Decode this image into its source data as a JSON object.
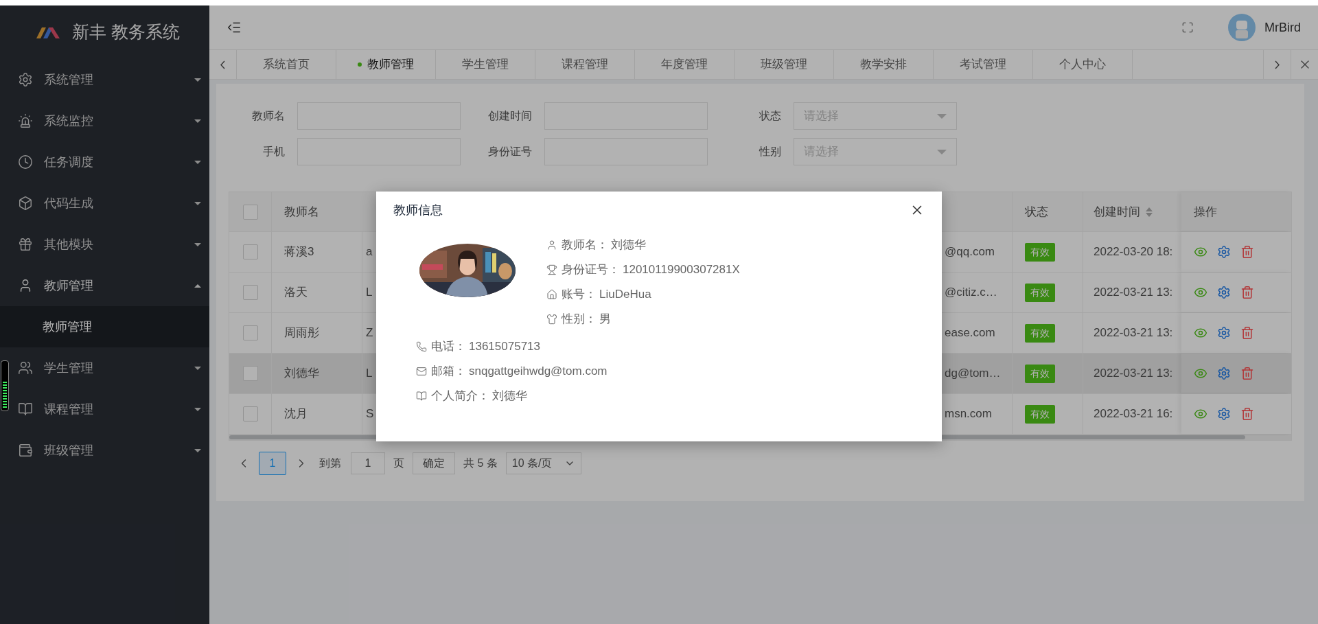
{
  "sidebar": {
    "logo_text": "新丰 教务系统",
    "menu": [
      {
        "label": "系统管理",
        "expanded": false
      },
      {
        "label": "系统监控",
        "expanded": false
      },
      {
        "label": "任务调度",
        "expanded": false
      },
      {
        "label": "代码生成",
        "expanded": false
      },
      {
        "label": "其他模块",
        "expanded": false
      },
      {
        "label": "教师管理",
        "expanded": true,
        "children": [
          {
            "label": "教师管理",
            "selected": true
          }
        ]
      },
      {
        "label": "学生管理",
        "expanded": false
      },
      {
        "label": "课程管理",
        "expanded": false
      },
      {
        "label": "班级管理",
        "expanded": false
      }
    ]
  },
  "header": {
    "user": "MrBird"
  },
  "tabs": [
    {
      "label": "系统首页",
      "selected": false
    },
    {
      "label": "教师管理",
      "selected": true
    },
    {
      "label": "学生管理",
      "selected": false
    },
    {
      "label": "课程管理",
      "selected": false
    },
    {
      "label": "年度管理",
      "selected": false
    },
    {
      "label": "班级管理",
      "selected": false
    },
    {
      "label": "教学安排",
      "selected": false
    },
    {
      "label": "考试管理",
      "selected": false
    },
    {
      "label": "个人中心",
      "selected": false
    }
  ],
  "filters": [
    {
      "label": "教师名",
      "kind": "input"
    },
    {
      "label": "创建时间",
      "kind": "input"
    },
    {
      "label": "状态",
      "kind": "select",
      "placeholder": "请选择"
    },
    {
      "label": "手机",
      "kind": "input"
    },
    {
      "label": "身份证号",
      "kind": "input"
    },
    {
      "label": "性别",
      "kind": "select",
      "placeholder": "请选择"
    }
  ],
  "table": {
    "all_checked": false,
    "columns": [
      {
        "label": "教师名"
      },
      {
        "label": "状态"
      },
      {
        "label": "创建时间",
        "sortable": true
      },
      {
        "label": "操作"
      }
    ],
    "rows": [
      {
        "checked": false,
        "highlighted": false,
        "name": "蒋溪3",
        "account": "a",
        "email": "@qq.com",
        "status": "有效",
        "created": "2022-03-20 18:"
      },
      {
        "checked": false,
        "highlighted": false,
        "name": "洛天",
        "account": "L",
        "email": "@citiz.c…",
        "status": "有效",
        "created": "2022-03-21 13:"
      },
      {
        "checked": false,
        "highlighted": false,
        "name": "周雨彤",
        "account": "Z",
        "email": "ease.com",
        "status": "有效",
        "created": "2022-03-21 13:"
      },
      {
        "checked": false,
        "highlighted": true,
        "name": "刘德华",
        "account": "L",
        "email": "dg@tom…",
        "status": "有效",
        "created": "2022-03-21 13:"
      },
      {
        "checked": false,
        "highlighted": false,
        "name": "沈月",
        "account": "S",
        "email": "msn.com",
        "status": "有效",
        "created": "2022-03-21 16:"
      }
    ]
  },
  "pagination": {
    "pages": [
      {
        "label": "1",
        "selected": true
      }
    ],
    "goto_label": "到第",
    "goto_value": "1",
    "page_unit": "页",
    "confirm": "确定",
    "total": "共 5 条",
    "page_size": "10 条/页"
  },
  "modal": {
    "title": "教师信息",
    "fields": [
      {
        "label": "教师名：",
        "value": "刘德华"
      },
      {
        "label": "身份证号：",
        "value": "12010119900307281X"
      },
      {
        "label": "账号：",
        "value": "LiuDeHua"
      },
      {
        "label": "性别：",
        "value": "男"
      }
    ],
    "extra_fields": [
      {
        "label": "电话：",
        "value": "13615075713"
      },
      {
        "label": "邮箱：",
        "value": "snqgattgeihwdg@tom.com"
      },
      {
        "label": "个人简介：",
        "value": "刘德华"
      }
    ]
  }
}
